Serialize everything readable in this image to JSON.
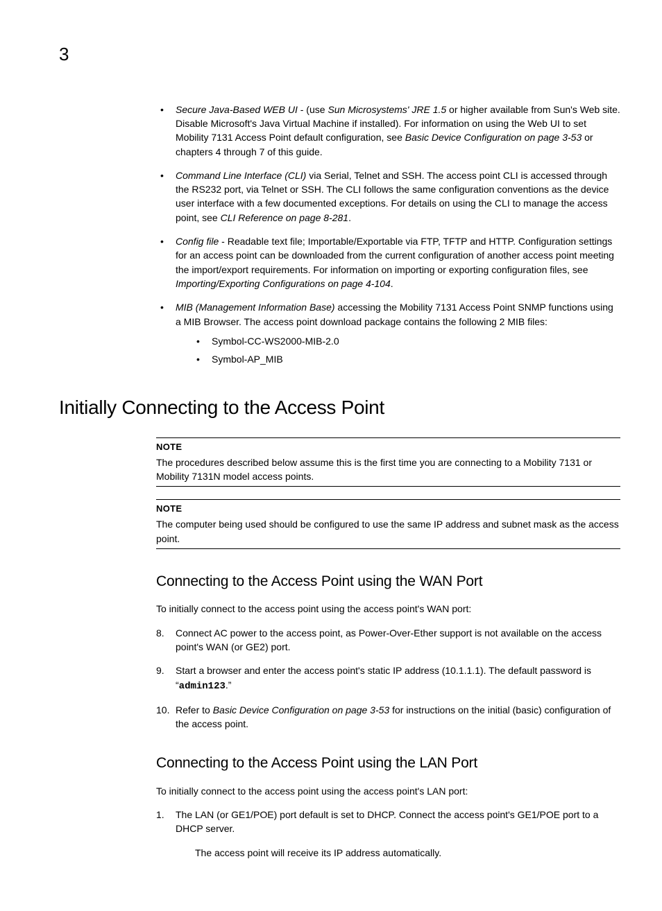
{
  "page_number": "3",
  "bullets": {
    "b1": {
      "lead": "Secure Java-Based WEB UI",
      "mid1": " - (use ",
      "em2": "Sun Microsystems' JRE 1.5",
      "mid2": " or higher available from Sun's Web site. Disable Microsoft's Java Virtual Machine if installed). For information on using the Web UI to set Mobility 7131 Access Point default configuration, see ",
      "em3": "Basic Device Configuration on page 3-53",
      "tail": " or chapters 4 through 7 of this guide."
    },
    "b2": {
      "lead": "Command Line Interface (CLI)",
      "mid1": " via Serial, Telnet and SSH. The access point CLI is accessed through the RS232 port, via Telnet or SSH. The CLI follows the same configuration conventions as the device user interface with a few documented exceptions. For details on using the CLI to manage the access point, see ",
      "em2": "CLI Reference on page 8-281",
      "tail": "."
    },
    "b3": {
      "lead": "Config file",
      "mid1": " - Readable text file; Importable/Exportable via FTP, TFTP and HTTP. Configuration settings for an access point can be downloaded from the current configuration of another access point meeting the import/export requirements. For information on importing or exporting configuration files, see ",
      "em2": "Importing/Exporting Configurations on page 4-104",
      "tail": "."
    },
    "b4": {
      "lead": "MIB (Management Information Base)",
      "mid1": " accessing the Mobility 7131 Access Point SNMP functions using a MIB Browser. The access point download package contains the following 2 MIB files:",
      "sub1": "Symbol-CC-WS2000-MIB-2.0",
      "sub2": "Symbol-AP_MIB"
    }
  },
  "heading_main": "Initially Connecting to the Access Point",
  "note1": {
    "label": "NOTE",
    "text": "The procedures described below assume this is the first time you are connecting to a Mobility 7131 or Mobility 7131N model access points."
  },
  "note2": {
    "label": "NOTE",
    "text": "The computer being used should be configured to use the same IP address and subnet mask as the access point."
  },
  "wan": {
    "heading": "Connecting to the Access Point using the WAN Port",
    "intro": "To initially connect to the access point using the access point's WAN port:",
    "s8": {
      "num": "8.",
      "text": "Connect AC power to the access point, as Power-Over-Ether support is not available on the access point's WAN (or GE2) port."
    },
    "s9": {
      "num": "9.",
      "pre": "Start a browser and enter the access point's static IP address (10.1.1.1). The default password is “",
      "code": "admin123",
      "post": ".”"
    },
    "s10": {
      "num": "10.",
      "pre": "Refer to ",
      "em": "Basic Device Configuration on page 3-53",
      "post": " for instructions on the initial (basic) configuration of the access point."
    }
  },
  "lan": {
    "heading": "Connecting to the Access Point using the LAN Port",
    "intro": "To initially connect to the access point using the access point's LAN port:",
    "s1": {
      "num": "1.",
      "text": "The LAN (or GE1/POE) port default is set to DHCP. Connect the access point's GE1/POE port to a DHCP server."
    },
    "sub": "The access point will receive its IP address automatically."
  }
}
